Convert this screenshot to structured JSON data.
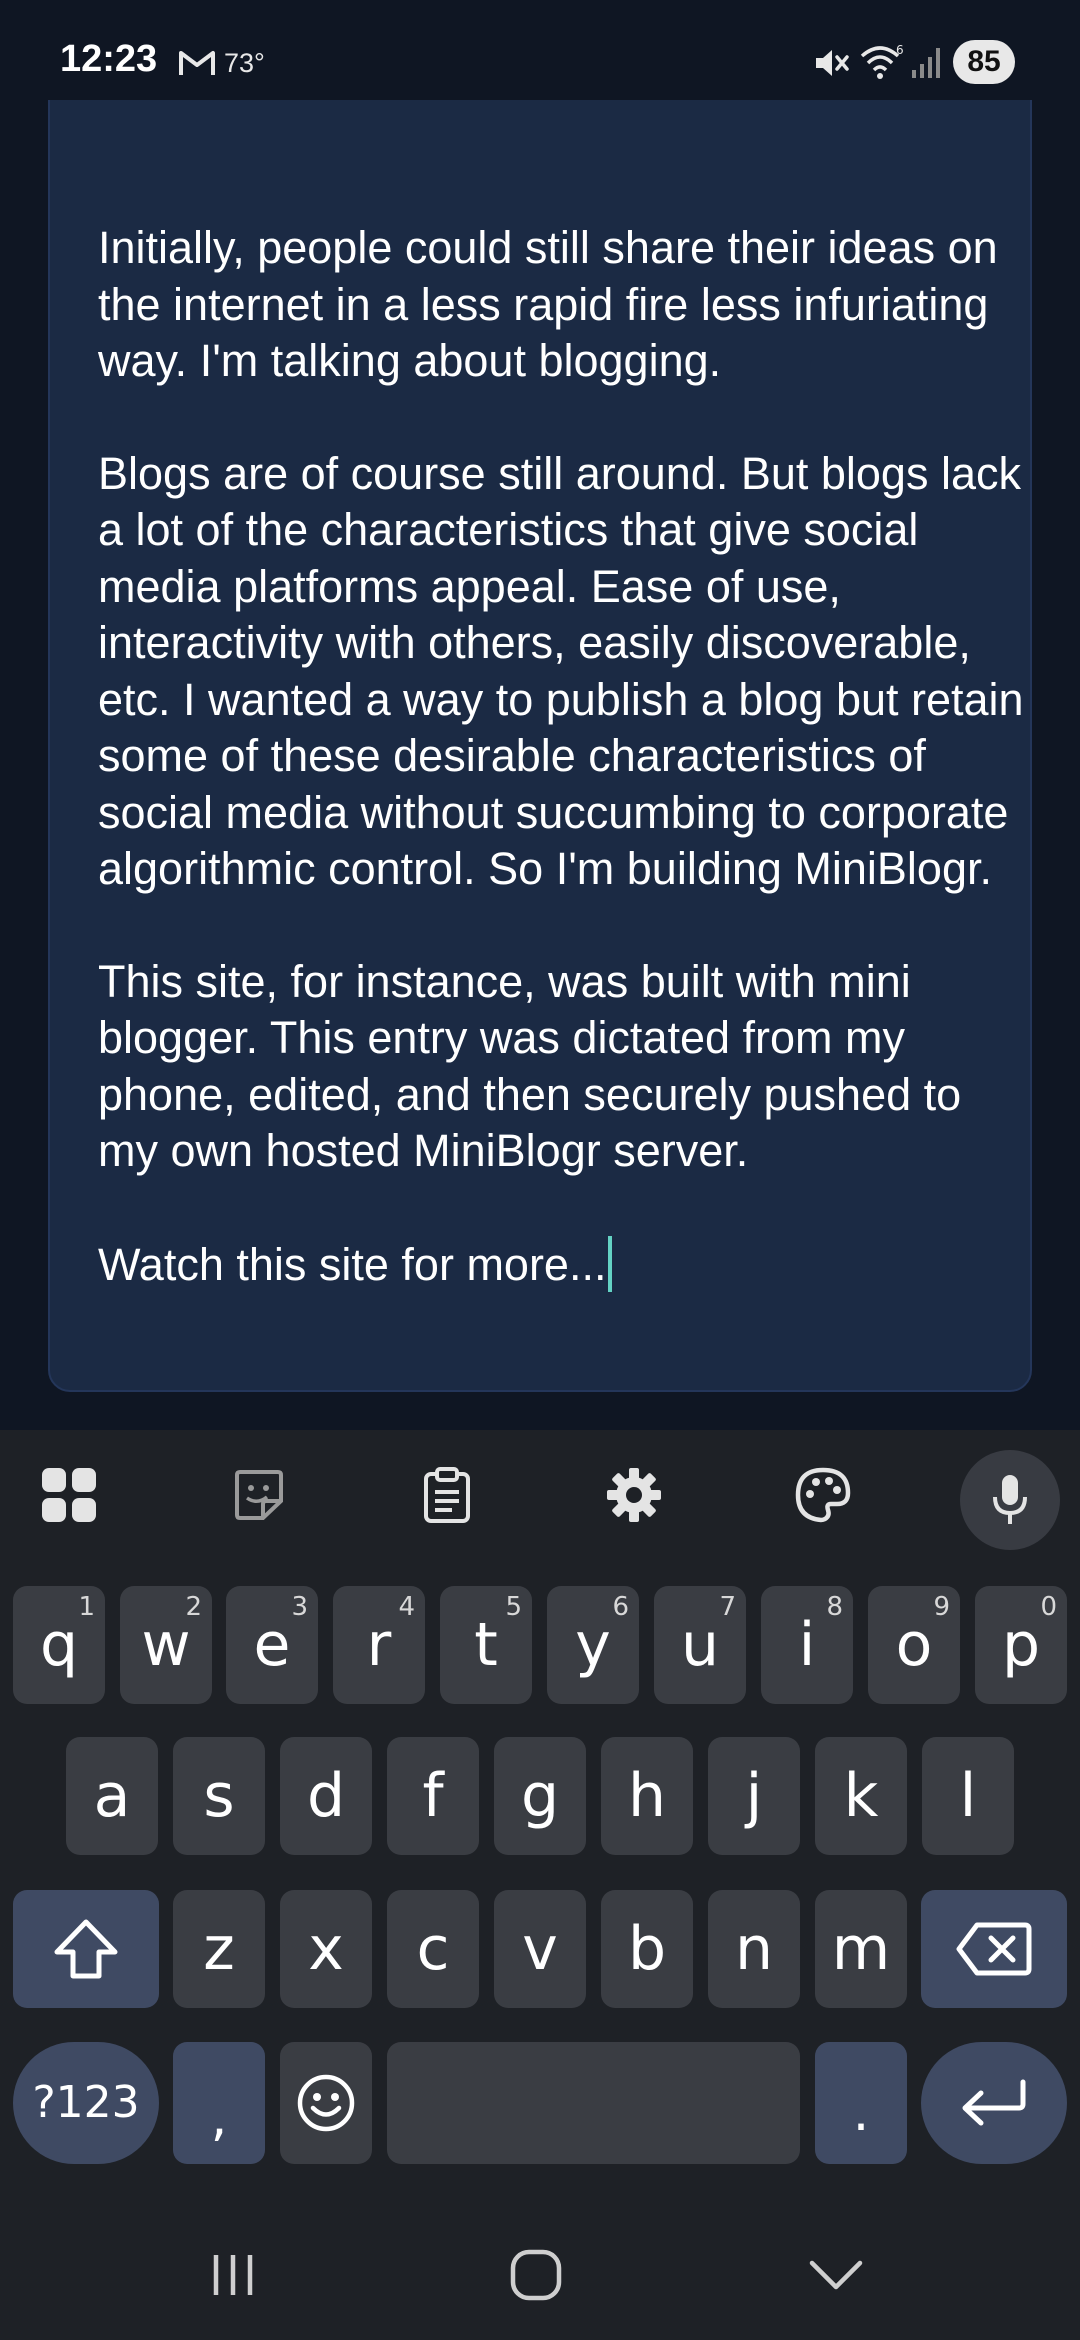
{
  "status_bar": {
    "time": "12:23",
    "temperature": "73°",
    "battery": "85",
    "icons": [
      "gmail-icon",
      "mute-icon",
      "wifi-6-icon",
      "signal-icon"
    ]
  },
  "editor": {
    "paragraphs": [
      "Initially, people could still share their ideas on the internet in a less rapid fire less infuriating way. I'm talking about blogging.",
      "Blogs are of course still around. But blogs lack a lot of the characteristics that give social media platforms appeal. Ease of use, interactivity with others, easily discoverable, etc. I wanted a way to publish a blog but retain some of these desirable characteristics of social media without succumbing to corporate algorithmic control. So I'm building MiniBlogr.",
      "This site, for instance, was built with mini blogger. This entry was dictated from my phone, edited, and then securely pushed to my own hosted MiniBlogr server.",
      "Watch this site for more..."
    ],
    "background": "#1b2a44",
    "cursor_color": "#64d2c4"
  },
  "keyboard": {
    "toolbar": [
      "apps-icon",
      "sticker-icon",
      "clipboard-icon",
      "settings-icon",
      "palette-icon",
      "mic-icon"
    ],
    "row1": [
      {
        "key": "q",
        "hint": "1"
      },
      {
        "key": "w",
        "hint": "2"
      },
      {
        "key": "e",
        "hint": "3"
      },
      {
        "key": "r",
        "hint": "4"
      },
      {
        "key": "t",
        "hint": "5"
      },
      {
        "key": "y",
        "hint": "6"
      },
      {
        "key": "u",
        "hint": "7"
      },
      {
        "key": "i",
        "hint": "8"
      },
      {
        "key": "o",
        "hint": "9"
      },
      {
        "key": "p",
        "hint": "0"
      }
    ],
    "row2": [
      "a",
      "s",
      "d",
      "f",
      "g",
      "h",
      "j",
      "k",
      "l"
    ],
    "row3": [
      "z",
      "x",
      "c",
      "v",
      "b",
      "n",
      "m"
    ],
    "row4": {
      "symbols": "?123",
      "comma": ",",
      "period": "."
    }
  },
  "nav_bar": [
    "recents-icon",
    "home-icon",
    "back-icon"
  ]
}
